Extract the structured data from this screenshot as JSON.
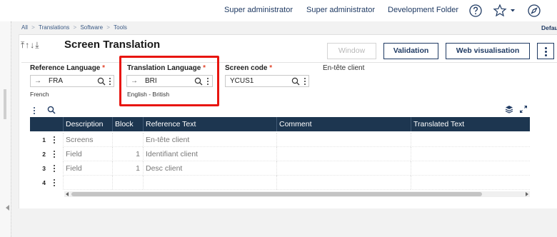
{
  "topbar": {
    "user_label": "Super administrator",
    "role_label": "Super administrator",
    "folder_label": "Development Folder",
    "icons": [
      "help-icon",
      "star-icon",
      "chevron-down-icon",
      "compass-icon"
    ]
  },
  "breadcrumb": {
    "items": [
      "All",
      "Translations",
      "Software",
      "Tools"
    ],
    "right_label": "Defau"
  },
  "page": {
    "nav_arrows": "⤒↑↓⤓",
    "title": "Screen Translation"
  },
  "toolbar": {
    "window_label": "Window",
    "validation_label": "Validation",
    "web_visualisation_label": "Web visualisation"
  },
  "form": {
    "reference_language": {
      "label": "Reference Language",
      "required_mark": "*",
      "arrow": "→",
      "value": "FRA",
      "description": "French"
    },
    "translation_language": {
      "label": "Translation Language",
      "required_mark": "*",
      "arrow": "→",
      "value": "BRI",
      "description": "English - British"
    },
    "screen_code": {
      "label": "Screen code",
      "required_mark": "*",
      "value": "YCUS1"
    },
    "screen_title": "En-tête client"
  },
  "grid": {
    "columns": [
      "Description",
      "Block",
      "Reference Text",
      "Comment",
      "Translated Text"
    ],
    "rows": [
      {
        "num": "1",
        "description": "Screens",
        "block": "",
        "reference_text": "En-tête client",
        "comment": "",
        "translated_text": ""
      },
      {
        "num": "2",
        "description": "Field",
        "block": "1",
        "reference_text": "Identifiant client",
        "comment": "",
        "translated_text": ""
      },
      {
        "num": "3",
        "description": "Field",
        "block": "1",
        "reference_text": "Desc client",
        "comment": "",
        "translated_text": ""
      },
      {
        "num": "4",
        "description": "",
        "block": "",
        "reference_text": "",
        "comment": "",
        "translated_text": ""
      }
    ]
  },
  "colors": {
    "primary": "#1f3a63",
    "grid_header": "#1d3650",
    "required": "#e2462c",
    "highlight": "#e8150f"
  }
}
